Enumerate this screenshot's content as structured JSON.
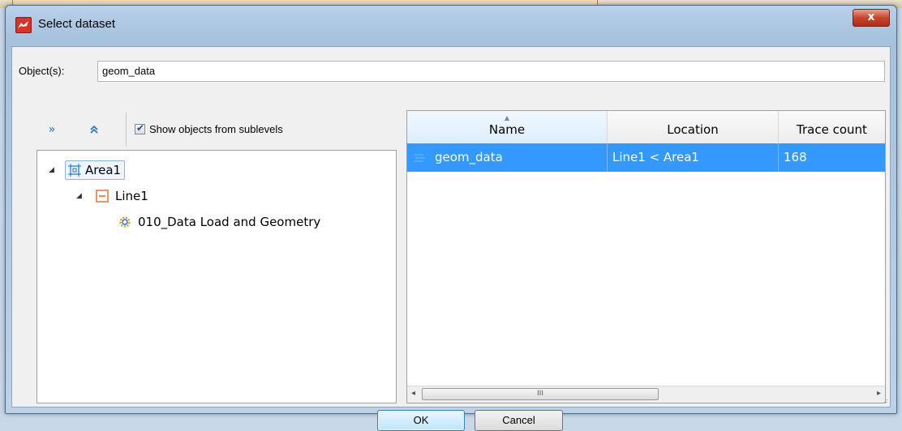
{
  "window": {
    "title": "Select dataset",
    "close_label": "x"
  },
  "objects": {
    "label": "Object(s):",
    "value": "geom_data"
  },
  "toolbar": {
    "expand_all_glyph": "»",
    "collapse_all_glyph": "⌃",
    "show_sublevels_checked": true,
    "show_sublevels_label": "Show objects from sublevels"
  },
  "tree": {
    "items": [
      {
        "label": "Area1",
        "level": 0,
        "icon": "area-icon",
        "expanded": true,
        "selected_outline": true
      },
      {
        "label": "Line1",
        "level": 1,
        "icon": "line-icon",
        "expanded": true
      },
      {
        "label": "010_Data Load and Geometry",
        "level": 2,
        "icon": "gear-icon"
      }
    ]
  },
  "table": {
    "columns": [
      "Name",
      "Location",
      "Trace count"
    ],
    "sorted_column": "Name",
    "rows": [
      {
        "name": "geom_data",
        "location": "Line1 < Area1",
        "trace_count": "168",
        "selected": true
      }
    ]
  },
  "scrollbar": {
    "left_arrow": "◂",
    "right_arrow": "▸",
    "thumb_grip": "III"
  },
  "buttons": {
    "ok": "OK",
    "cancel": "Cancel"
  },
  "colors": {
    "selection": "#3399ff",
    "accent_icon": "#1a73c8",
    "line_icon": "#e06a2c"
  }
}
